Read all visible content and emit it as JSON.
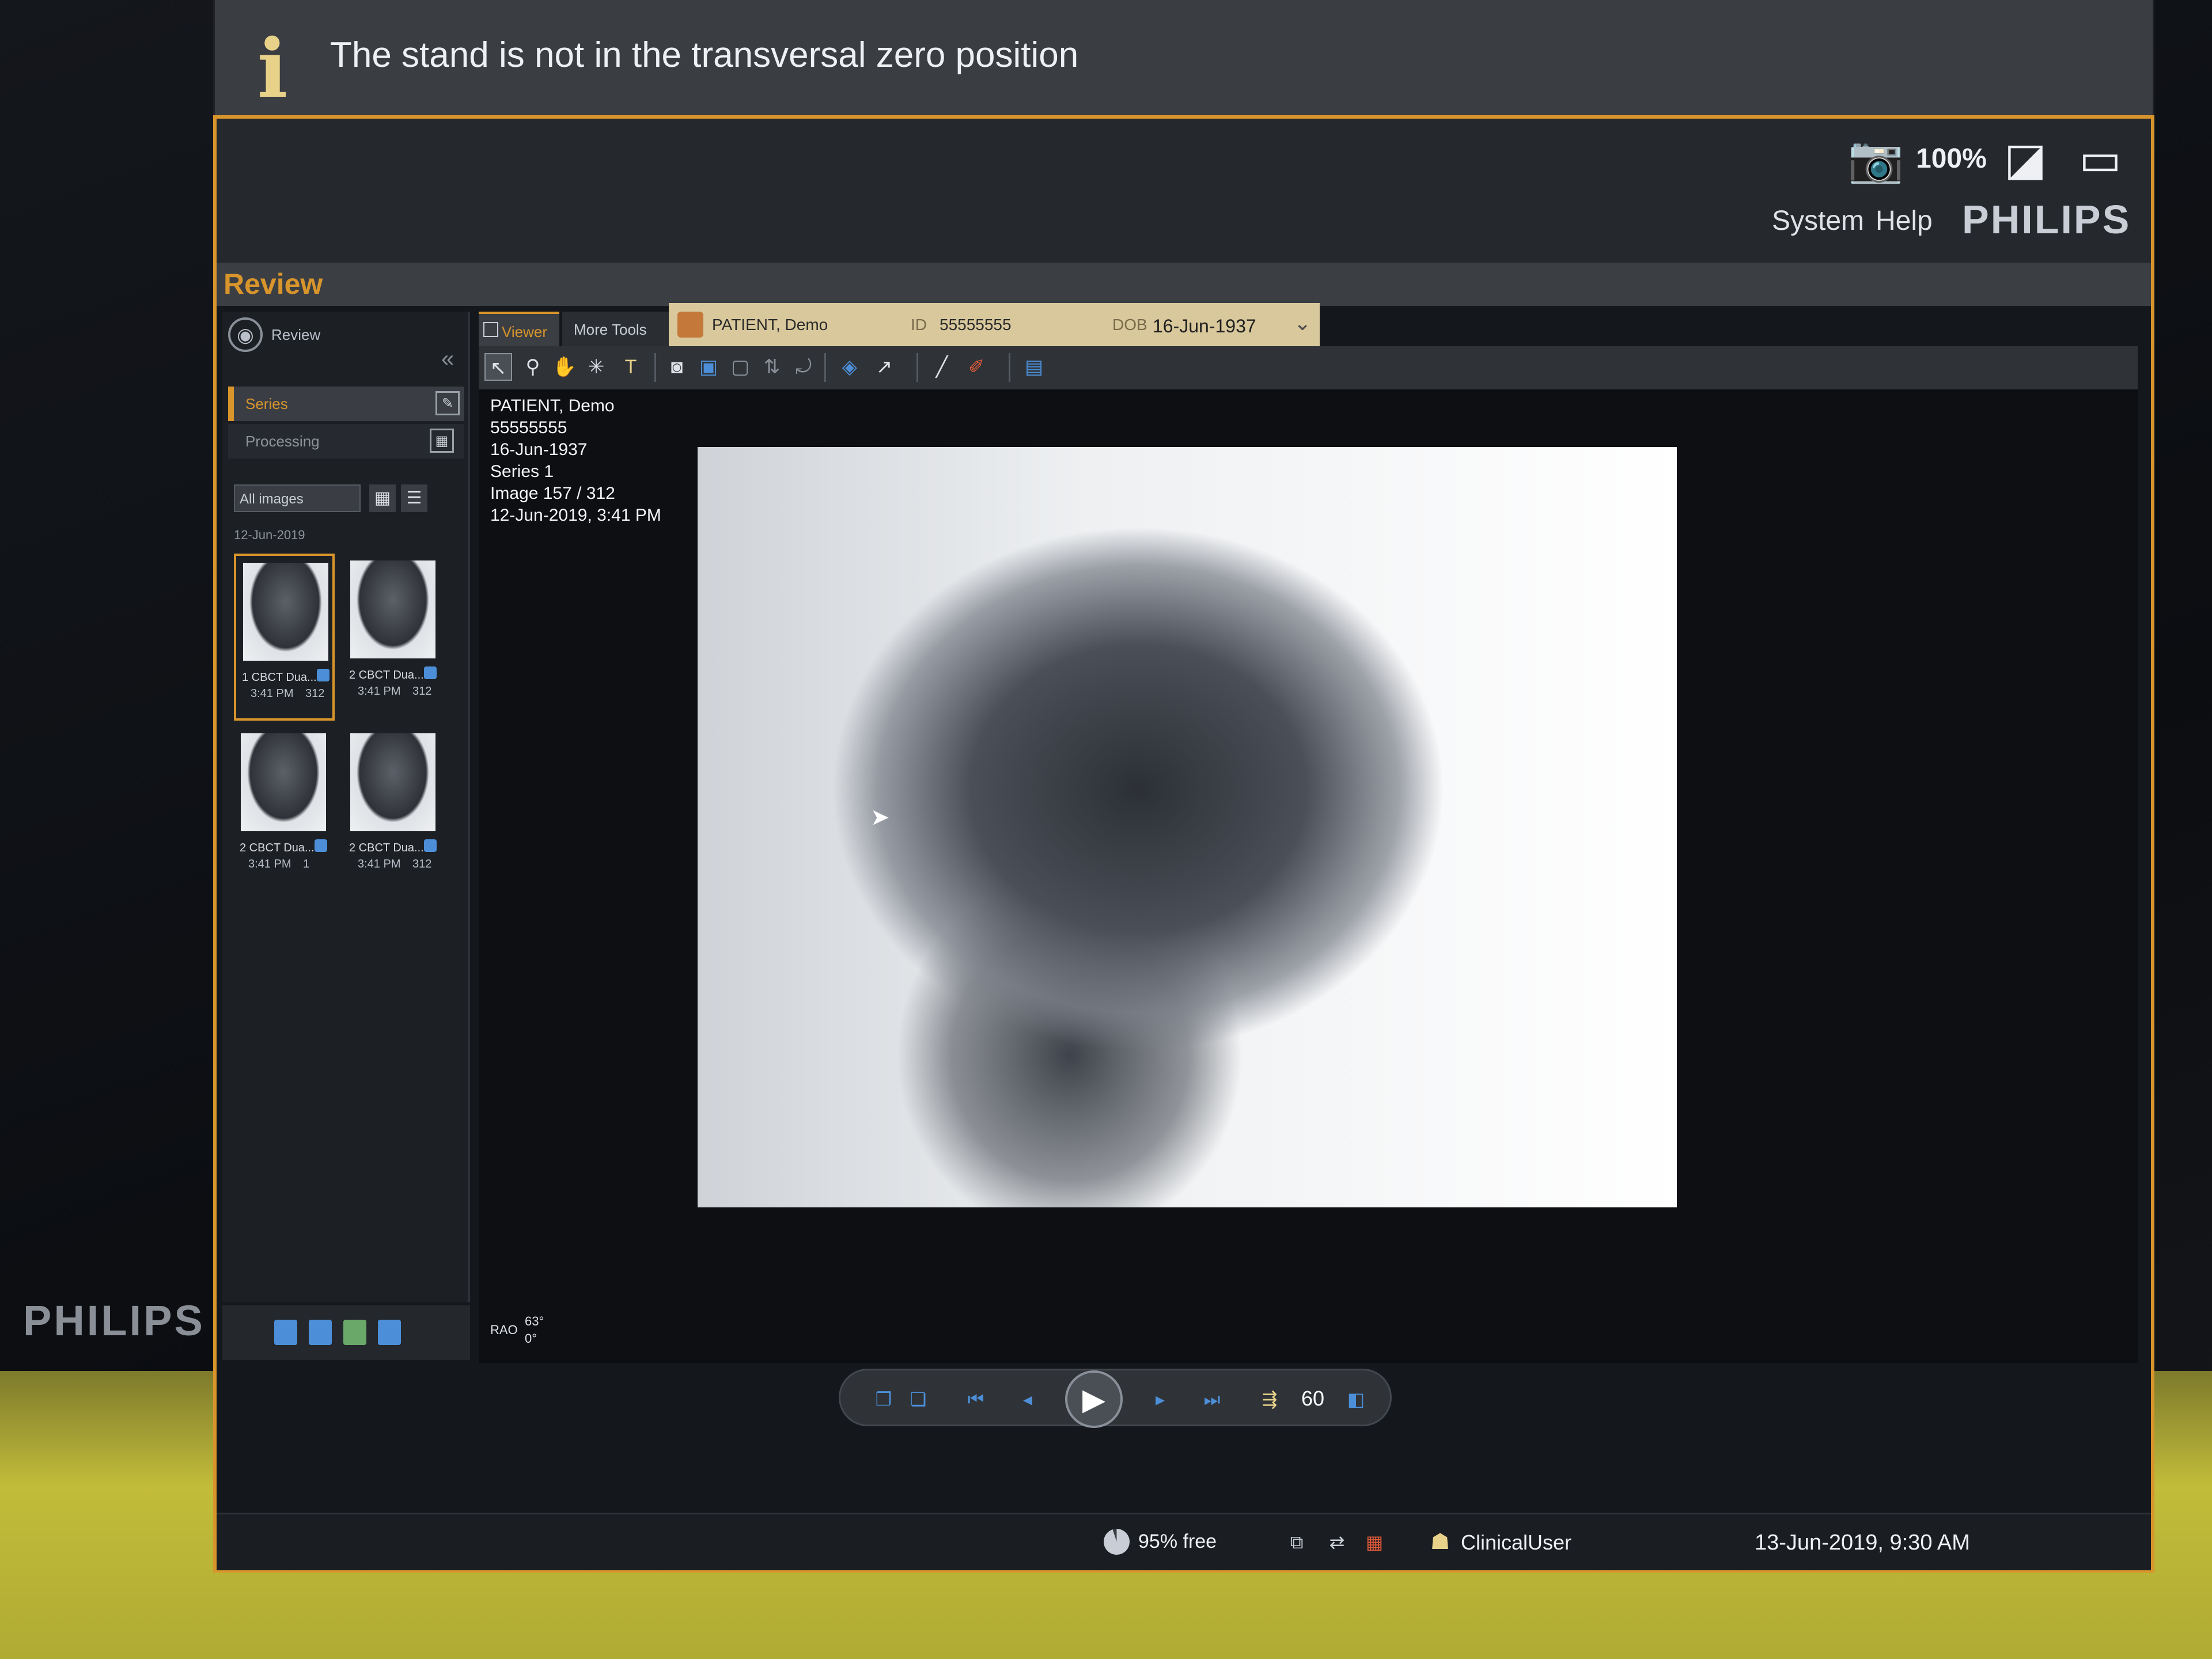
{
  "notification": {
    "text": "The stand is not in the transversal zero position",
    "icon": "info-icon"
  },
  "brand": {
    "monitor_logo": "PHILIPS",
    "app_logo": "PHILIPS",
    "accent_color": "#d8952c"
  },
  "top_menu": {
    "system": "System",
    "help": "Help",
    "icons": [
      "camera-icon",
      "zoom-100-icon",
      "adjust-icon",
      "window-icon"
    ],
    "zoom_label": "100%"
  },
  "window": {
    "title": "Review"
  },
  "left_panel": {
    "nav_label": "Review",
    "tabs": [
      {
        "label": "Series",
        "active": true
      },
      {
        "label": "Processing",
        "active": false
      }
    ],
    "filter": "All images",
    "date_header": "12-Jun-2019",
    "thumbnails": [
      {
        "label": "1 CBCT Dua...",
        "time": "3:41 PM",
        "count": "312",
        "selected": true
      },
      {
        "label": "2 CBCT Dua...",
        "time": "3:41 PM",
        "count": "312",
        "selected": false
      },
      {
        "label": "2 CBCT Dua...",
        "time": "3:41 PM",
        "count": "1",
        "selected": false
      },
      {
        "label": "2 CBCT Dua...",
        "time": "3:41 PM",
        "count": "312",
        "selected": false
      }
    ]
  },
  "tabs": {
    "viewer": "Viewer",
    "more_tools": "More Tools"
  },
  "patient_banner": {
    "name": "PATIENT, Demo",
    "id_label": "ID",
    "id": "55555555",
    "dob_label": "DOB",
    "dob": "16-Jun-1937"
  },
  "overlay": {
    "lines": [
      "PATIENT, Demo",
      "55555555",
      "16-Jun-1937",
      "Series 1",
      "Image 157 / 312",
      "12-Jun-2019, 3:41 PM"
    ],
    "orientation": "RAO",
    "angle_primary": "63°",
    "angle_secondary": "0°"
  },
  "playback": {
    "frame_rate": "60"
  },
  "status": {
    "disk_free": "95% free",
    "disk_free_fraction": 0.95,
    "user": "ClinicalUser",
    "datetime": "13-Jun-2019, 9:30 AM"
  }
}
